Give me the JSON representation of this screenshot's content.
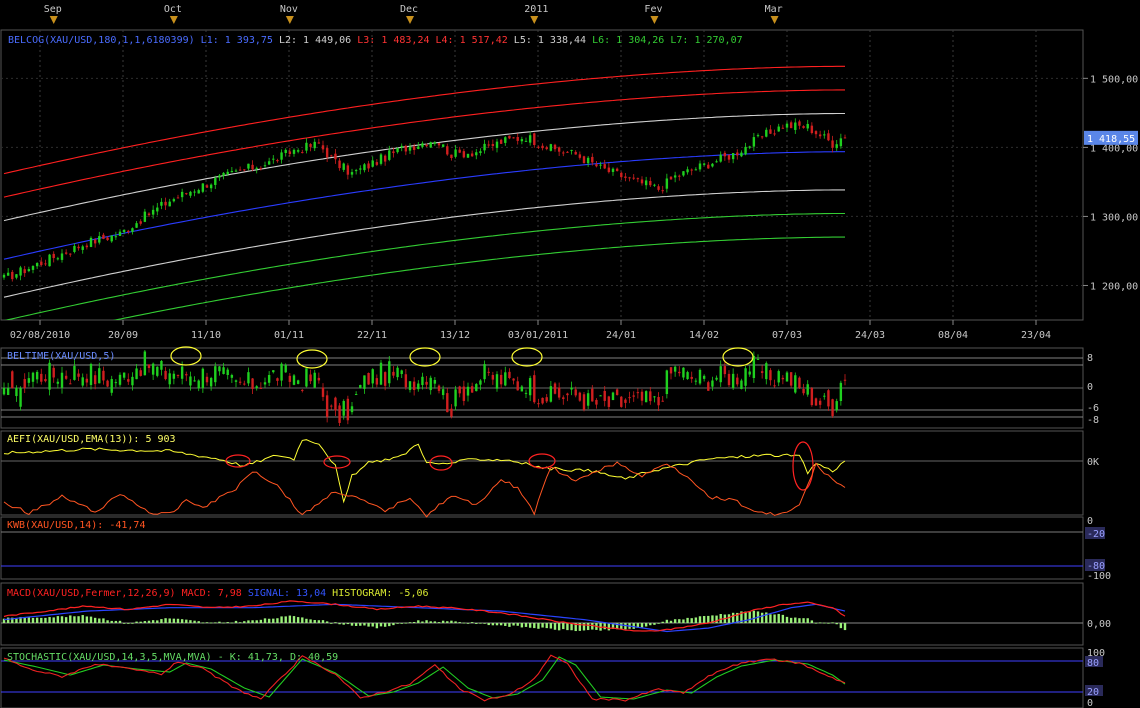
{
  "colors": {
    "background": "#000000",
    "grid": "#3a3a3a",
    "frame": "#5a5a5a",
    "up": "#1fd01f",
    "down": "#d01f1f",
    "text": "#c8c8c8",
    "blue": "#2244ff",
    "yellow": "#ffff33",
    "red": "#ff2222",
    "orange": "#ff5522",
    "green": "#33cc33",
    "white": "#d0d0d0",
    "marker": "#c8901c"
  },
  "chart_data": [
    {
      "type": "candlestick",
      "id": "price",
      "title_parts": [
        {
          "text": "BELCOG(XAU/USD,180,1,1,6180399)",
          "color": "#4a6cff"
        },
        {
          "text": "L1: 1 393,75",
          "color": "#4a6cff"
        },
        {
          "text": "L2: 1 449,06",
          "color": "#d0d0d0"
        },
        {
          "text": "L3: 1 483,24",
          "color": "#ff3333"
        },
        {
          "text": "L4: 1 517,42",
          "color": "#ff3333"
        },
        {
          "text": "L5: 1 338,44",
          "color": "#d0d0d0"
        },
        {
          "text": "L6: 1 304,26",
          "color": "#33cc33"
        },
        {
          "text": "L7: 1 270,07",
          "color": "#33cc33"
        }
      ],
      "month_markers": [
        "Sep",
        "Oct",
        "Nov",
        "Dec",
        "2011",
        "Fev",
        "Mar"
      ],
      "x_tick_labels": [
        "02/08/2010",
        "20/09",
        "11/10",
        "01/11",
        "22/11",
        "13/12",
        "03/01/2011",
        "24/01",
        "14/02",
        "07/03",
        "24/03",
        "08/04",
        "23/04"
      ],
      "y_tick_labels": [
        "1 500,00",
        "1 400,00",
        "1 300,00",
        "1 200,00"
      ],
      "ylim": [
        1150,
        1570
      ],
      "last_price_label": "1 418,55",
      "bands": [
        {
          "name": "L4",
          "color": "#ff2020",
          "start": 1362,
          "end": 1517.42
        },
        {
          "name": "L3",
          "color": "#ff2020",
          "start": 1328,
          "end": 1483.24
        },
        {
          "name": "L2",
          "color": "#d0d0d0",
          "start": 1294,
          "end": 1449.06
        },
        {
          "name": "L1",
          "color": "#2a3cff",
          "start": 1238,
          "end": 1393.75
        },
        {
          "name": "L5",
          "color": "#d0d0d0",
          "start": 1183,
          "end": 1338.44
        },
        {
          "name": "L6",
          "color": "#33cc33",
          "start": 1149,
          "end": 1304.26
        },
        {
          "name": "L7",
          "color": "#33cc33",
          "start": 1115,
          "end": 1270.07
        }
      ],
      "close_anchors": [
        [
          0,
          1210
        ],
        [
          10,
          1236
        ],
        [
          20,
          1262
        ],
        [
          28,
          1275
        ],
        [
          34,
          1300
        ],
        [
          40,
          1323
        ],
        [
          46,
          1340
        ],
        [
          52,
          1355
        ],
        [
          58,
          1368
        ],
        [
          64,
          1378
        ],
        [
          70,
          1396
        ],
        [
          76,
          1405
        ],
        [
          80,
          1378
        ],
        [
          84,
          1362
        ],
        [
          90,
          1380
        ],
        [
          96,
          1398
        ],
        [
          104,
          1412
        ],
        [
          108,
          1390
        ],
        [
          114,
          1394
        ],
        [
          120,
          1408
        ],
        [
          126,
          1416
        ],
        [
          132,
          1398
        ],
        [
          138,
          1390
        ],
        [
          144,
          1370
        ],
        [
          152,
          1352
        ],
        [
          158,
          1340
        ],
        [
          162,
          1358
        ],
        [
          168,
          1372
        ],
        [
          176,
          1390
        ],
        [
          182,
          1412
        ],
        [
          188,
          1432
        ],
        [
          194,
          1430
        ],
        [
          200,
          1406
        ],
        [
          203,
          1418
        ]
      ]
    },
    {
      "type": "candlestick",
      "id": "beltime",
      "title": "BELTIME(XAU/USD,5)",
      "y_tick_labels": [
        "8",
        "0",
        "-6",
        "-8"
      ]
    },
    {
      "type": "line",
      "id": "aefi",
      "title": "AEFI(XAU/USD,EMA(13)): 5 903",
      "y_tick_labels": [
        "0K"
      ],
      "anchors": [
        [
          0,
          0.08
        ],
        [
          20,
          0.12
        ],
        [
          40,
          0.1
        ],
        [
          52,
          0.02
        ],
        [
          58,
          -0.05
        ],
        [
          66,
          0.06
        ],
        [
          70,
          0.02
        ],
        [
          72,
          0.22
        ],
        [
          76,
          0.18
        ],
        [
          80,
          -0.05
        ],
        [
          82,
          -0.42
        ],
        [
          84,
          -0.15
        ],
        [
          88,
          -0.02
        ],
        [
          96,
          0.05
        ],
        [
          100,
          0.18
        ],
        [
          102,
          -0.02
        ],
        [
          106,
          -0.03
        ],
        [
          114,
          0.02
        ],
        [
          122,
          0.01
        ],
        [
          130,
          -0.07
        ],
        [
          134,
          -0.08
        ],
        [
          142,
          -0.1
        ],
        [
          150,
          -0.18
        ],
        [
          156,
          -0.1
        ],
        [
          162,
          -0.05
        ],
        [
          170,
          0.02
        ],
        [
          184,
          0.06
        ],
        [
          192,
          0.05
        ],
        [
          194,
          -0.12
        ],
        [
          196,
          -0.02
        ],
        [
          200,
          -0.1
        ],
        [
          203,
          0.0
        ]
      ]
    },
    {
      "type": "line",
      "id": "kwb",
      "title": "KWB(XAU/USD,14): -41,74",
      "y_tick_labels": [
        "0",
        "-20",
        "-80",
        "-100"
      ],
      "ylim": [
        -100,
        0
      ],
      "anchors": [
        [
          0,
          -30
        ],
        [
          6,
          -12
        ],
        [
          14,
          -40
        ],
        [
          22,
          -14
        ],
        [
          28,
          -45
        ],
        [
          36,
          -10
        ],
        [
          40,
          -10
        ],
        [
          44,
          -35
        ],
        [
          48,
          -22
        ],
        [
          56,
          -55
        ],
        [
          60,
          -85
        ],
        [
          66,
          -60
        ],
        [
          72,
          -8
        ],
        [
          80,
          -50
        ],
        [
          86,
          -35
        ],
        [
          92,
          -15
        ],
        [
          98,
          -40
        ],
        [
          102,
          -8
        ],
        [
          108,
          -42
        ],
        [
          114,
          -25
        ],
        [
          120,
          -70
        ],
        [
          124,
          -55
        ],
        [
          128,
          -12
        ],
        [
          132,
          -92
        ],
        [
          138,
          -65
        ],
        [
          142,
          -82
        ],
        [
          148,
          -98
        ],
        [
          154,
          -75
        ],
        [
          160,
          -98
        ],
        [
          166,
          -70
        ],
        [
          170,
          -40
        ],
        [
          176,
          -35
        ],
        [
          182,
          -12
        ],
        [
          188,
          -10
        ],
        [
          192,
          -25
        ],
        [
          196,
          -95
        ],
        [
          200,
          -70
        ],
        [
          203,
          -55
        ]
      ]
    },
    {
      "type": "line",
      "id": "macd",
      "title_parts": [
        {
          "text": "MACD(XAU/USD,Fermer,12,26,9)",
          "color": "#ff2222"
        },
        {
          "text": "MACD: 7,98",
          "color": "#ff2222"
        },
        {
          "text": "SIGNAL: 13,04",
          "color": "#3355ff"
        },
        {
          "text": "HISTOGRAM: -5,06",
          "color": "#d8e830"
        }
      ],
      "y_tick_labels": [
        "0,00"
      ],
      "macd_anchors": [
        [
          0,
          8
        ],
        [
          10,
          14
        ],
        [
          20,
          20
        ],
        [
          30,
          16
        ],
        [
          40,
          22
        ],
        [
          50,
          18
        ],
        [
          60,
          20
        ],
        [
          70,
          26
        ],
        [
          80,
          22
        ],
        [
          90,
          16
        ],
        [
          100,
          20
        ],
        [
          110,
          17
        ],
        [
          120,
          12
        ],
        [
          128,
          6
        ],
        [
          136,
          0
        ],
        [
          146,
          -6
        ],
        [
          154,
          -10
        ],
        [
          160,
          -8
        ],
        [
          170,
          0
        ],
        [
          180,
          14
        ],
        [
          188,
          22
        ],
        [
          194,
          24
        ],
        [
          200,
          18
        ],
        [
          203,
          8
        ]
      ],
      "signal_anchors": [
        [
          0,
          4
        ],
        [
          20,
          14
        ],
        [
          40,
          18
        ],
        [
          60,
          18
        ],
        [
          80,
          22
        ],
        [
          100,
          18
        ],
        [
          120,
          14
        ],
        [
          140,
          4
        ],
        [
          160,
          -10
        ],
        [
          170,
          -6
        ],
        [
          180,
          4
        ],
        [
          190,
          18
        ],
        [
          196,
          22
        ],
        [
          203,
          14
        ]
      ],
      "histogram_note": "computed as MACD minus SIGNAL"
    },
    {
      "type": "line",
      "id": "stochastic",
      "title": "STOCHASTIC(XAU/USD,14,3,5,MVA,MVA) - K: 41,73, D: 40,59",
      "y_tick_labels": [
        "100",
        "80",
        "20",
        "0"
      ],
      "ylim": [
        0,
        100
      ],
      "k_anchors": [
        [
          0,
          92
        ],
        [
          6,
          70
        ],
        [
          14,
          55
        ],
        [
          22,
          80
        ],
        [
          30,
          70
        ],
        [
          38,
          60
        ],
        [
          42,
          85
        ],
        [
          48,
          70
        ],
        [
          56,
          30
        ],
        [
          62,
          10
        ],
        [
          72,
          95
        ],
        [
          80,
          60
        ],
        [
          86,
          12
        ],
        [
          92,
          25
        ],
        [
          98,
          40
        ],
        [
          104,
          78
        ],
        [
          110,
          30
        ],
        [
          116,
          8
        ],
        [
          122,
          18
        ],
        [
          128,
          50
        ],
        [
          132,
          98
        ],
        [
          136,
          80
        ],
        [
          142,
          10
        ],
        [
          150,
          8
        ],
        [
          158,
          30
        ],
        [
          164,
          22
        ],
        [
          170,
          55
        ],
        [
          176,
          78
        ],
        [
          184,
          90
        ],
        [
          192,
          82
        ],
        [
          198,
          60
        ],
        [
          203,
          42
        ]
      ],
      "d_anchors": [
        [
          0,
          88
        ],
        [
          8,
          74
        ],
        [
          16,
          58
        ],
        [
          24,
          78
        ],
        [
          32,
          70
        ],
        [
          40,
          64
        ],
        [
          44,
          82
        ],
        [
          50,
          70
        ],
        [
          58,
          32
        ],
        [
          64,
          14
        ],
        [
          72,
          90
        ],
        [
          80,
          62
        ],
        [
          88,
          16
        ],
        [
          94,
          24
        ],
        [
          100,
          42
        ],
        [
          106,
          74
        ],
        [
          112,
          32
        ],
        [
          118,
          12
        ],
        [
          124,
          20
        ],
        [
          130,
          48
        ],
        [
          134,
          94
        ],
        [
          138,
          78
        ],
        [
          144,
          14
        ],
        [
          152,
          10
        ],
        [
          160,
          28
        ],
        [
          166,
          22
        ],
        [
          172,
          54
        ],
        [
          178,
          76
        ],
        [
          186,
          88
        ],
        [
          194,
          80
        ],
        [
          200,
          58
        ],
        [
          203,
          40
        ]
      ]
    }
  ]
}
